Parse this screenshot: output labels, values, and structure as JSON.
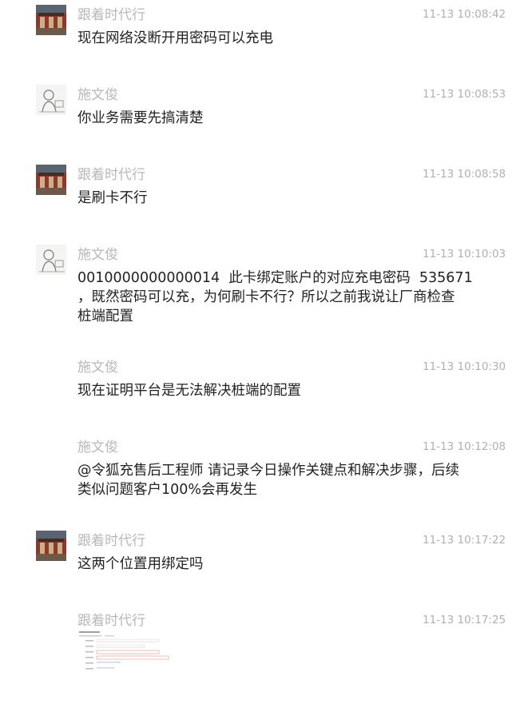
{
  "messages": [
    {
      "avatar": "building-avatar",
      "sender": "跟着时代行",
      "time": "11-13 10:08:42",
      "text": "现在网络没断开用密码可以充电"
    },
    {
      "avatar": "person-avatar",
      "sender": "施文俊",
      "time": "11-13 10:08:53",
      "text": "你业务需要先搞清楚"
    },
    {
      "avatar": "building-avatar",
      "sender": "跟着时代行",
      "time": "11-13 10:08:58",
      "text": "是刷卡不行"
    },
    {
      "avatar": "person-avatar",
      "sender": "施文俊",
      "time": "11-13 10:10:03",
      "text_lines": [
        "0010000000000014  此卡绑定账户的对应充电密码  535671",
        "，既然密码可以充，为何刷卡不行？所以之前我说让厂商检查",
        "桩端配置"
      ]
    },
    {
      "avatar": "",
      "sender": "施文俊",
      "time": "11-13 10:10:30",
      "text": "现在证明平台是无法解决桩端的配置"
    },
    {
      "avatar": "",
      "sender": "施文俊",
      "time": "11-13 10:12:08",
      "text_lines": [
        "@令狐充售后工程师 请记录今日操作关键点和解决步骤，后续",
        "类似问题客户100%会再发生"
      ]
    },
    {
      "avatar": "building-avatar",
      "sender": "跟着时代行",
      "time": "11-13 10:17:22",
      "text": "这两个位置用绑定吗"
    },
    {
      "avatar": "",
      "sender": "跟着时代行",
      "time": "11-13 10:17:25",
      "image": "screenshot-thumbnail"
    }
  ]
}
